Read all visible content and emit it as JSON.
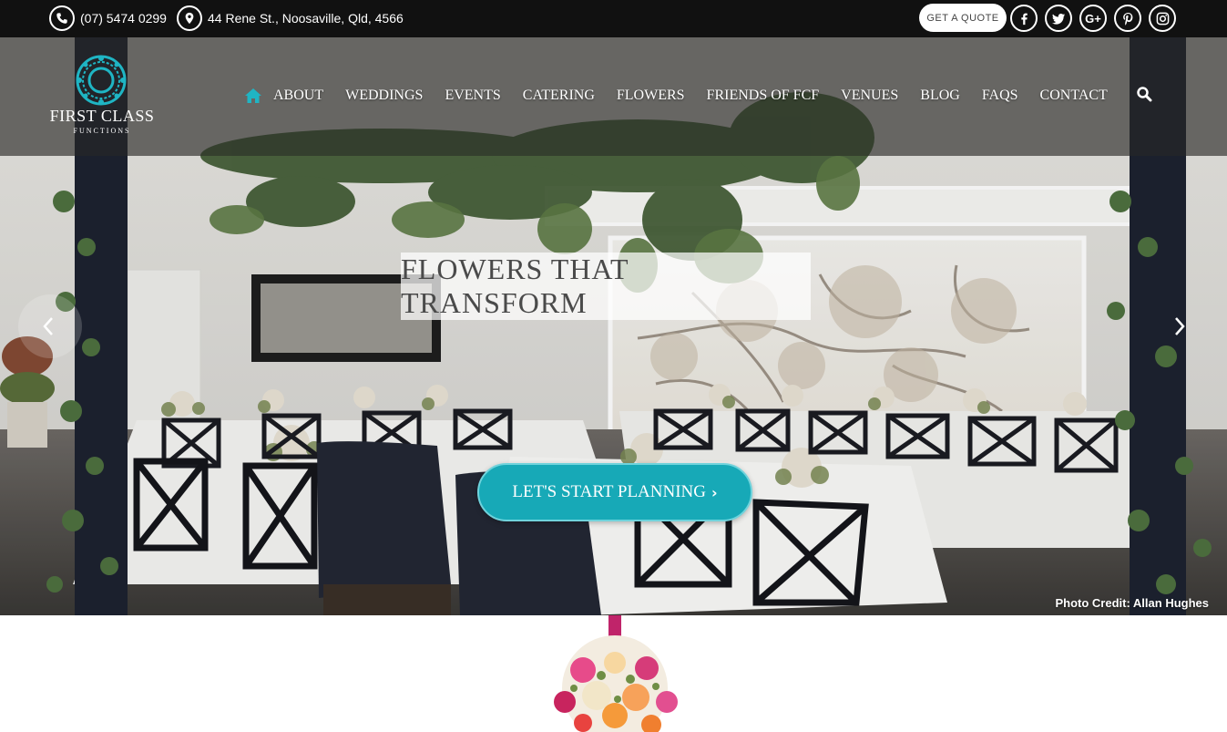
{
  "topbar": {
    "phone": "(07) 5474 0299",
    "address": "44 Rene St., Noosaville, Qld, 4566",
    "quote_button": "GET A QUOTE",
    "social": [
      {
        "name": "facebook",
        "glyph": "f"
      },
      {
        "name": "twitter",
        "glyph": "twitter-bird"
      },
      {
        "name": "google-plus",
        "glyph": "G+"
      },
      {
        "name": "pinterest",
        "glyph": "P"
      },
      {
        "name": "instagram",
        "glyph": "instagram"
      }
    ]
  },
  "logo": {
    "name": "FIRST CLASS",
    "sub": "FUNCTIONS"
  },
  "nav": {
    "items": [
      "ABOUT",
      "WEDDINGS",
      "EVENTS",
      "CATERING",
      "FLOWERS",
      "FRIENDS OF FCF",
      "VENUES",
      "BLOG",
      "FAQS",
      "CONTACT"
    ]
  },
  "hero": {
    "title": "FLOWERS THAT TRANSFORM",
    "cta": "LET'S START PLANNING",
    "credit": "Photo Credit: Allan Hughes"
  },
  "colors": {
    "topbar": "#111111",
    "accent": "#17a9b7",
    "home_icon": "#1fb5c4"
  }
}
